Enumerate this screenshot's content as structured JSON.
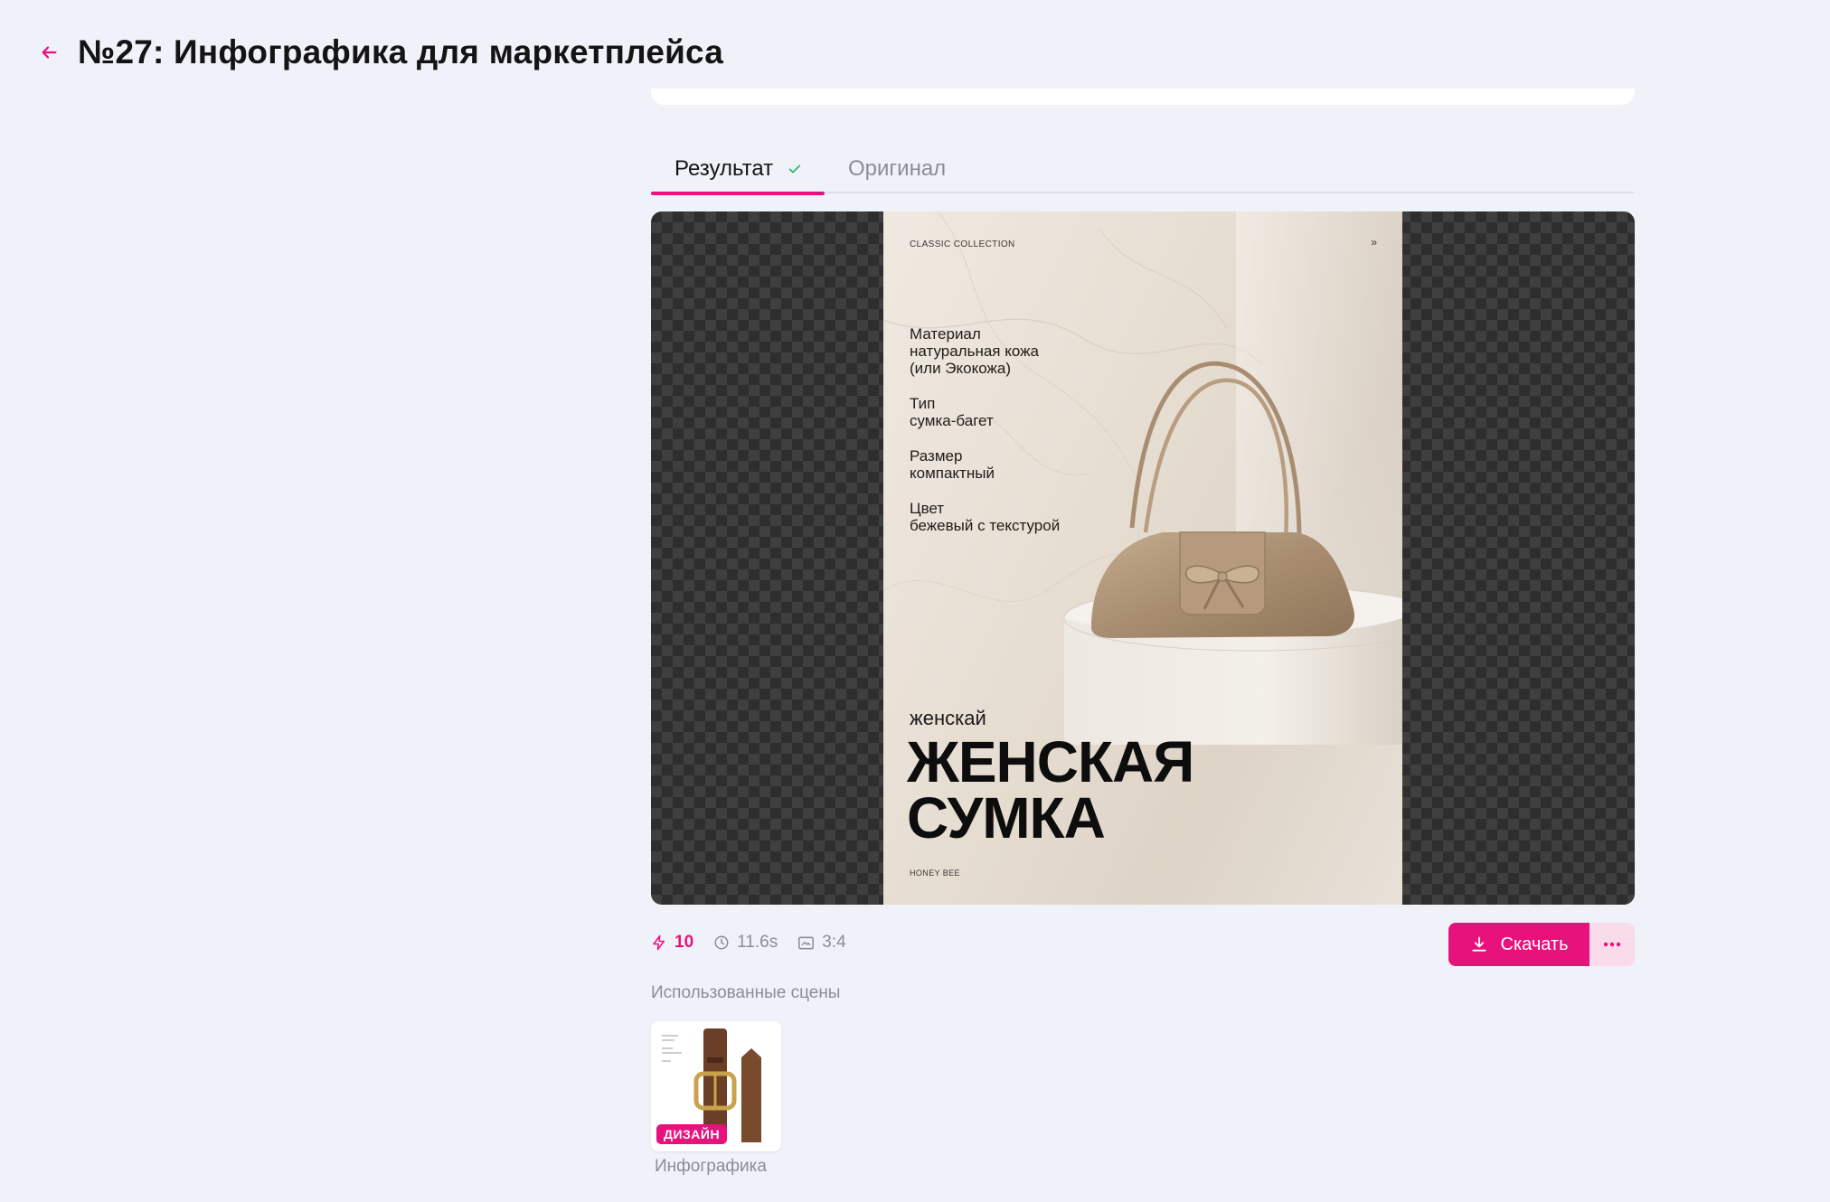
{
  "header": {
    "title": "№27: Инфографика для маркетплейса",
    "back_icon": "arrow-left-icon"
  },
  "tabs": [
    {
      "label": "Результат",
      "active": true,
      "status_icon": "check-icon"
    },
    {
      "label": "Оригинал",
      "active": false
    }
  ],
  "result_image": {
    "top_label": "CLASSIC COLLECTION",
    "corner_mark": "»",
    "specs": [
      {
        "name": "Материал",
        "value_lines": [
          "натуральная кожа",
          "(или Экокожа)"
        ]
      },
      {
        "name": "Тип",
        "value_lines": [
          "сумка-багет"
        ]
      },
      {
        "name": "Размер",
        "value_lines": [
          "компактный"
        ]
      },
      {
        "name": "Цвет",
        "value_lines": [
          "бежевый с текстурой"
        ]
      }
    ],
    "subtitle": "женскай",
    "title_line1": "ЖЕНСКАЯ",
    "title_line2": "СУМКА",
    "brand": "HONEY BEE"
  },
  "meta": {
    "credits": "10",
    "credits_icon": "lightning-icon",
    "time": "11.6s",
    "time_icon": "clock-icon",
    "ratio": "3:4",
    "ratio_icon": "aspect-ratio-icon"
  },
  "actions": {
    "download_label": "Скачать",
    "download_icon": "download-icon",
    "more_icon": "more-dots-icon"
  },
  "scenes": {
    "section_label": "Использованные сцены",
    "items": [
      {
        "badge": "ДИЗАЙН",
        "caption": "Инфографика"
      }
    ]
  },
  "colors": {
    "accent": "#e8127c",
    "background": "#f0f2f9",
    "success": "#2bb673",
    "muted_text": "#8a8d98"
  }
}
